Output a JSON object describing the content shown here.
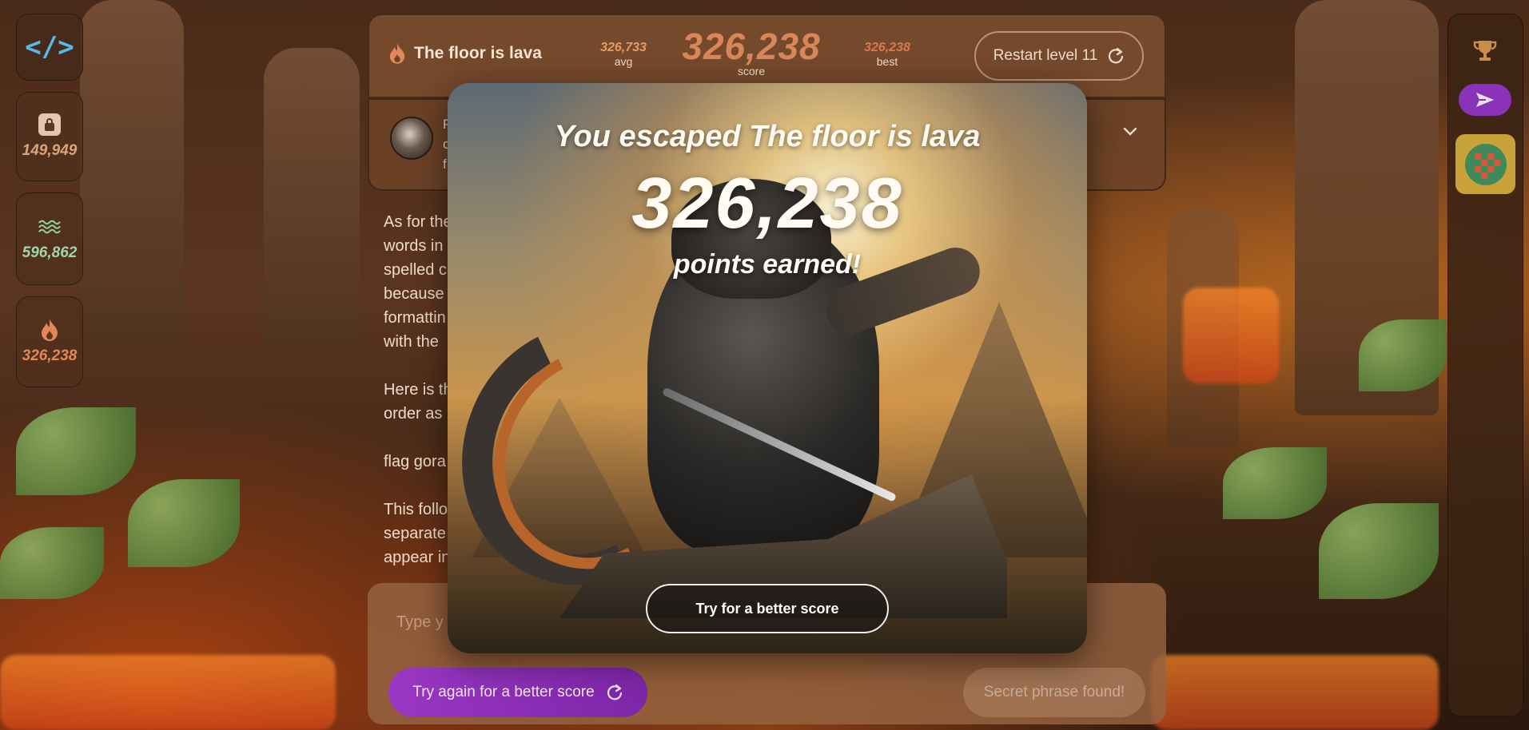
{
  "sidebar": {
    "logo": "</>",
    "stats": [
      {
        "icon": "padlock-icon",
        "value": "149,949",
        "color": "#d9a57a"
      },
      {
        "icon": "waves-icon",
        "value": "596,862",
        "color": "#9fd4ad"
      },
      {
        "icon": "flame-icon",
        "value": "326,238",
        "color": "#e2875a"
      }
    ]
  },
  "header": {
    "level_name": "The floor is lava",
    "avg_value": "326,733",
    "avg_label": "avg",
    "score_value": "326,238",
    "score_label": "score",
    "best_value": "326,238",
    "best_label": "best",
    "restart_label": "Restart level 11"
  },
  "bot": {
    "lines": [
      "P",
      "c",
      "f"
    ]
  },
  "chat": {
    "paragraphs": [
      "As for the words in spelled c because formattin with the",
      "Here is t order as",
      "flag gora",
      "This follo separate appear in"
    ],
    "lines": [
      [
        "As for the",
        "words in",
        "spelled c",
        "because",
        "formattin",
        "with the"
      ],
      [
        "Here is th",
        "order as"
      ],
      [
        "flag gora"
      ],
      [
        "This follo",
        "separate",
        "appear in"
      ]
    ]
  },
  "input": {
    "placeholder": "Type y",
    "retry_label": "Try again for a better score",
    "secret_label": "Secret phrase found!"
  },
  "modal": {
    "title": "You escaped The floor is lava",
    "score": "326,238",
    "subtitle": "points earned!",
    "button_label": "Try for a better score"
  },
  "colors": {
    "accent_purple": "#8a32b8",
    "score_orange": "#d9875a",
    "logo_blue": "#58b8e8"
  }
}
